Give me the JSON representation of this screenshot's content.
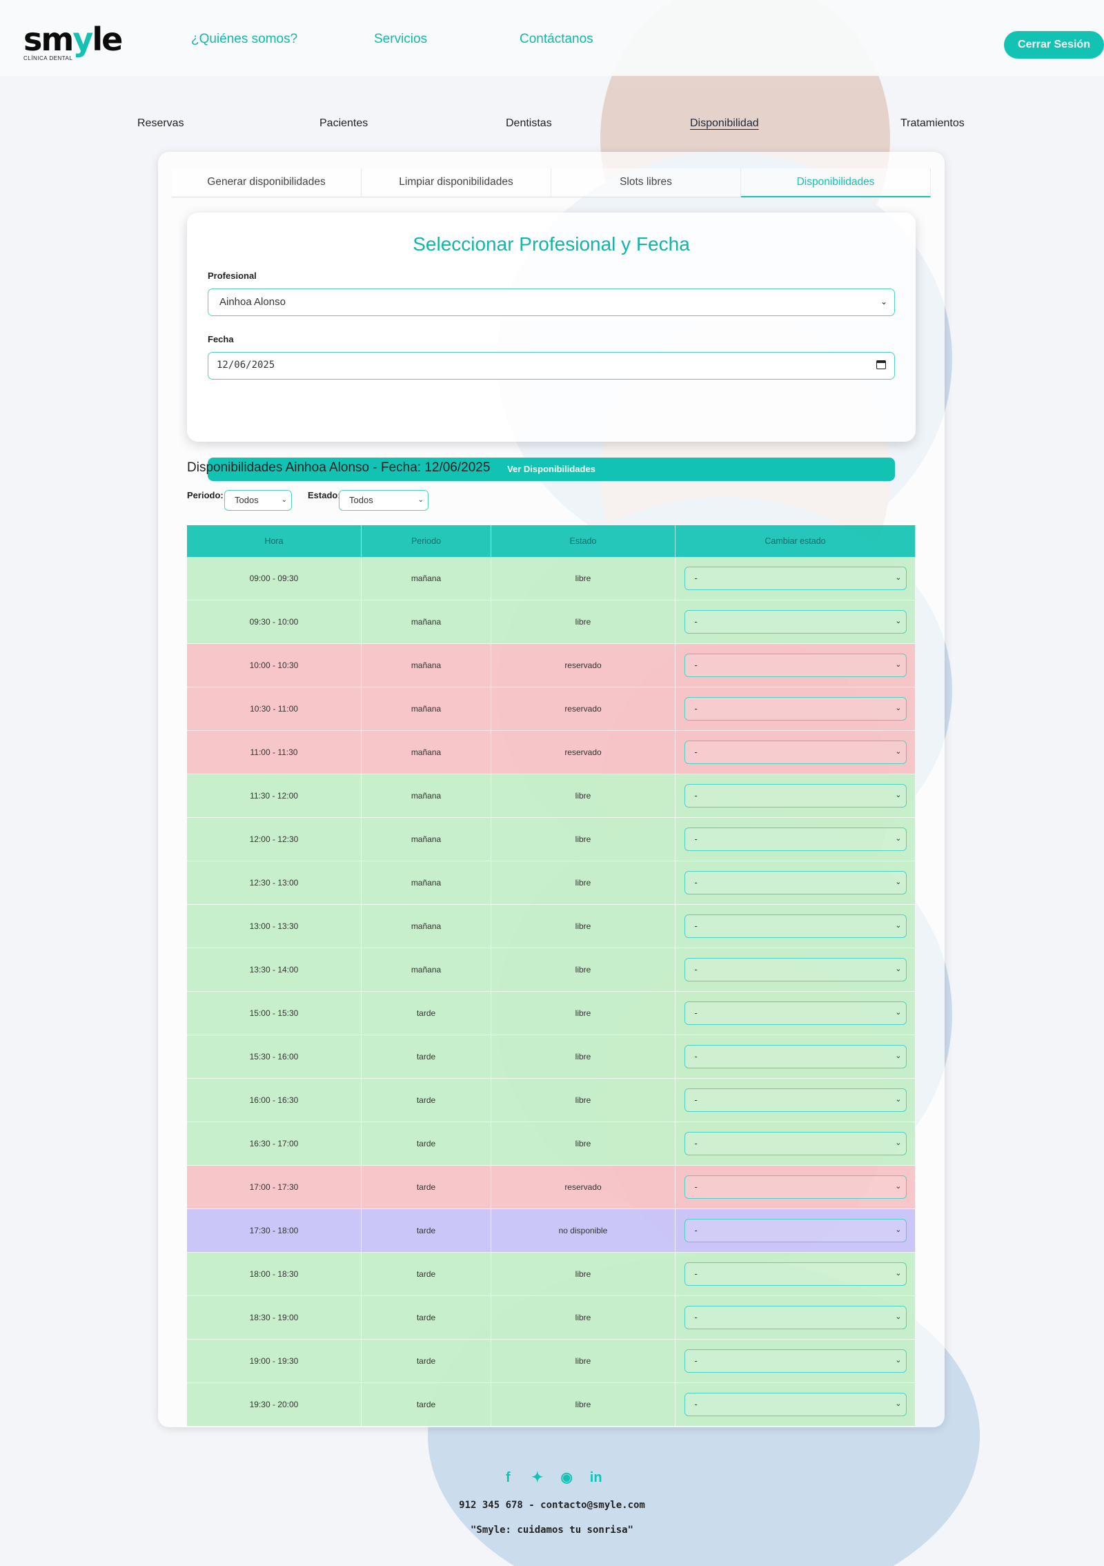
{
  "brand": {
    "logo": "smyle",
    "logo_sub": "CLÍNICA DENTAL",
    "accent": "#12c2b3"
  },
  "topnav": {
    "about": "¿Quiénes somos?",
    "services": "Servicios",
    "contact": "Contáctanos",
    "logout": "Cerrar Sesión"
  },
  "subnav": {
    "reservas": "Reservas",
    "pacientes": "Pacientes",
    "dentistas": "Dentistas",
    "disponibilidad": "Disponibilidad",
    "tratamientos": "Tratamientos"
  },
  "tabs": {
    "generar": "Generar disponibilidades",
    "limpiar": "Limpiar disponibilidades",
    "slots": "Slots libres",
    "disponibilidades": "Disponibilidades"
  },
  "form": {
    "title": "Seleccionar Profesional y Fecha",
    "profesional_label": "Profesional",
    "profesional_value": "Ainhoa Alonso",
    "fecha_label": "Fecha",
    "fecha_value": "12/06/2025",
    "submit": "Ver Disponibilidades"
  },
  "results": {
    "title": "Disponibilidades Ainhoa Alonso - Fecha: 12/06/2025",
    "periodo_label": "Periodo:",
    "periodo_value": "Todos",
    "estado_label": "Estado:",
    "estado_value": "Todos",
    "headers": {
      "hora": "Hora",
      "periodo": "Periodo",
      "estado": "Estado",
      "cambiar": "Cambiar estado"
    },
    "select_value": "-",
    "rows": [
      {
        "hora": "09:00 - 09:30",
        "periodo": "mañana",
        "estado": "libre"
      },
      {
        "hora": "09:30 - 10:00",
        "periodo": "mañana",
        "estado": "libre"
      },
      {
        "hora": "10:00 - 10:30",
        "periodo": "mañana",
        "estado": "reservado"
      },
      {
        "hora": "10:30 - 11:00",
        "periodo": "mañana",
        "estado": "reservado"
      },
      {
        "hora": "11:00 - 11:30",
        "periodo": "mañana",
        "estado": "reservado"
      },
      {
        "hora": "11:30 - 12:00",
        "periodo": "mañana",
        "estado": "libre"
      },
      {
        "hora": "12:00 - 12:30",
        "periodo": "mañana",
        "estado": "libre"
      },
      {
        "hora": "12:30 - 13:00",
        "periodo": "mañana",
        "estado": "libre"
      },
      {
        "hora": "13:00 - 13:30",
        "periodo": "mañana",
        "estado": "libre"
      },
      {
        "hora": "13:30 - 14:00",
        "periodo": "mañana",
        "estado": "libre"
      },
      {
        "hora": "15:00 - 15:30",
        "periodo": "tarde",
        "estado": "libre"
      },
      {
        "hora": "15:30 - 16:00",
        "periodo": "tarde",
        "estado": "libre"
      },
      {
        "hora": "16:00 - 16:30",
        "periodo": "tarde",
        "estado": "libre"
      },
      {
        "hora": "16:30 - 17:00",
        "periodo": "tarde",
        "estado": "libre"
      },
      {
        "hora": "17:00 - 17:30",
        "periodo": "tarde",
        "estado": "reservado"
      },
      {
        "hora": "17:30 - 18:00",
        "periodo": "tarde",
        "estado": "no disponible"
      },
      {
        "hora": "18:00 - 18:30",
        "periodo": "tarde",
        "estado": "libre"
      },
      {
        "hora": "18:30 - 19:00",
        "periodo": "tarde",
        "estado": "libre"
      },
      {
        "hora": "19:00 - 19:30",
        "periodo": "tarde",
        "estado": "libre"
      },
      {
        "hora": "19:30 - 20:00",
        "periodo": "tarde",
        "estado": "libre"
      }
    ]
  },
  "footer": {
    "contact": "912 345 678 - contacto@smyle.com",
    "slogan": "\"Smyle: cuidamos tu sonrisa\"",
    "social_icons": [
      "facebook-icon",
      "twitter-icon",
      "instagram-icon",
      "linkedin-icon"
    ]
  }
}
